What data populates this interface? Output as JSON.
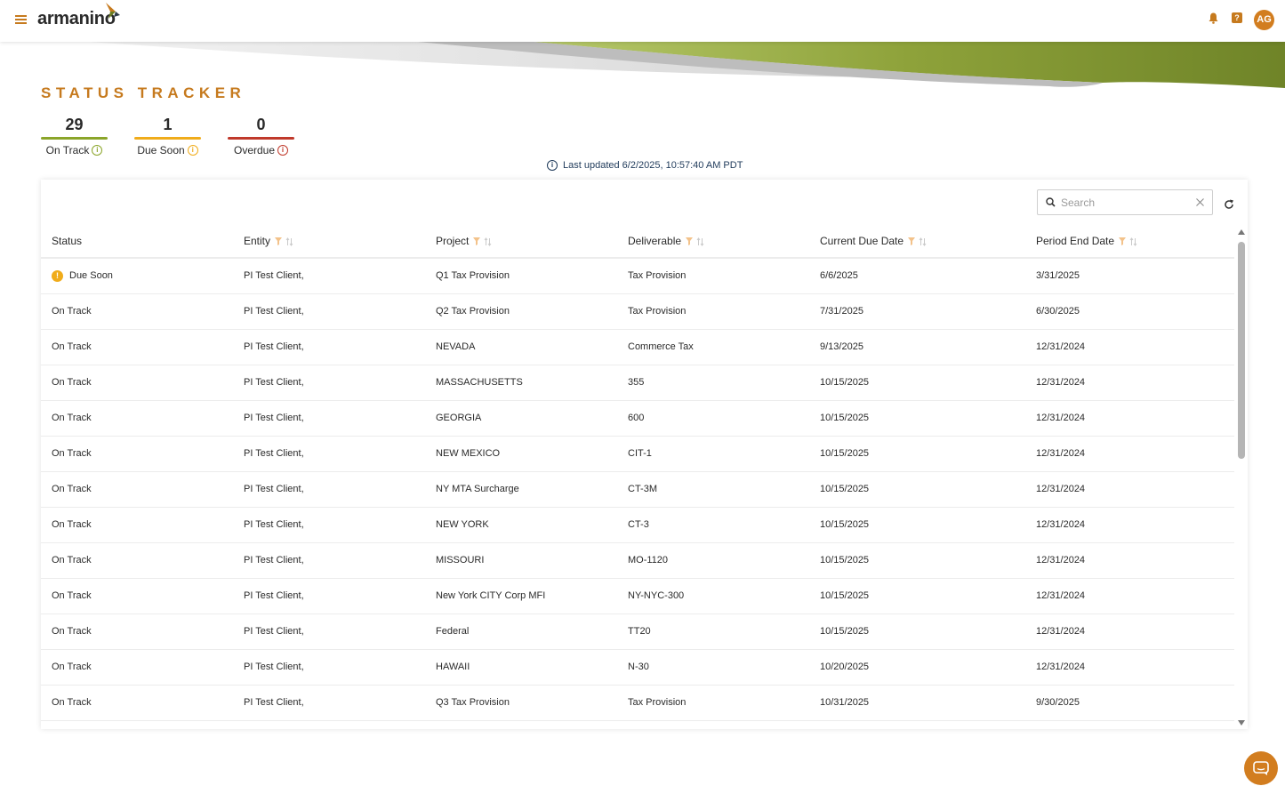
{
  "header": {
    "logo_text": "armanino",
    "avatar_initials": "AG",
    "help_symbol": "?"
  },
  "page": {
    "title": "STATUS TRACKER"
  },
  "summary": [
    {
      "count": "29",
      "label": "On Track",
      "color": "#8ba52a"
    },
    {
      "count": "1",
      "label": "Due Soon",
      "color": "#f0ac1b"
    },
    {
      "count": "0",
      "label": "Overdue",
      "color": "#c0392b"
    }
  ],
  "last_updated": "Last updated 6/2/2025, 10:57:40 AM PDT",
  "search": {
    "placeholder": "Search"
  },
  "table": {
    "columns": [
      "Status",
      "Entity",
      "Project",
      "Deliverable",
      "Current Due Date",
      "Period End Date"
    ],
    "rows": [
      {
        "status": "Due Soon",
        "entity": "PI Test Client,",
        "project": "Q1 Tax Provision",
        "deliverable": "Tax Provision",
        "due": "6/6/2025",
        "period_end": "3/31/2025"
      },
      {
        "status": "On Track",
        "entity": "PI Test Client,",
        "project": "Q2 Tax Provision",
        "deliverable": "Tax Provision",
        "due": "7/31/2025",
        "period_end": "6/30/2025"
      },
      {
        "status": "On Track",
        "entity": "PI Test Client,",
        "project": "NEVADA",
        "deliverable": "Commerce Tax",
        "due": "9/13/2025",
        "period_end": "12/31/2024"
      },
      {
        "status": "On Track",
        "entity": "PI Test Client,",
        "project": "MASSACHUSETTS",
        "deliverable": "355",
        "due": "10/15/2025",
        "period_end": "12/31/2024"
      },
      {
        "status": "On Track",
        "entity": "PI Test Client,",
        "project": "GEORGIA",
        "deliverable": "600",
        "due": "10/15/2025",
        "period_end": "12/31/2024"
      },
      {
        "status": "On Track",
        "entity": "PI Test Client,",
        "project": "NEW MEXICO",
        "deliverable": "CIT-1",
        "due": "10/15/2025",
        "period_end": "12/31/2024"
      },
      {
        "status": "On Track",
        "entity": "PI Test Client,",
        "project": "NY MTA Surcharge",
        "deliverable": "CT-3M",
        "due": "10/15/2025",
        "period_end": "12/31/2024"
      },
      {
        "status": "On Track",
        "entity": "PI Test Client,",
        "project": "NEW YORK",
        "deliverable": "CT-3",
        "due": "10/15/2025",
        "period_end": "12/31/2024"
      },
      {
        "status": "On Track",
        "entity": "PI Test Client,",
        "project": "MISSOURI",
        "deliverable": "MO-1120",
        "due": "10/15/2025",
        "period_end": "12/31/2024"
      },
      {
        "status": "On Track",
        "entity": "PI Test Client,",
        "project": "New York CITY Corp MFI",
        "deliverable": "NY-NYC-300",
        "due": "10/15/2025",
        "period_end": "12/31/2024"
      },
      {
        "status": "On Track",
        "entity": "PI Test Client,",
        "project": "Federal",
        "deliverable": "TT20",
        "due": "10/15/2025",
        "period_end": "12/31/2024"
      },
      {
        "status": "On Track",
        "entity": "PI Test Client,",
        "project": "HAWAII",
        "deliverable": "N-30",
        "due": "10/20/2025",
        "period_end": "12/31/2024"
      },
      {
        "status": "On Track",
        "entity": "PI Test Client,",
        "project": "Q3 Tax Provision",
        "deliverable": "Tax Provision",
        "due": "10/31/2025",
        "period_end": "9/30/2025"
      }
    ]
  },
  "colors": {
    "accent": "#c67a1e",
    "due_soon": "#f0ac1b",
    "text_dark": "#2a2a2a",
    "link_blue": "#1f3a5a"
  }
}
